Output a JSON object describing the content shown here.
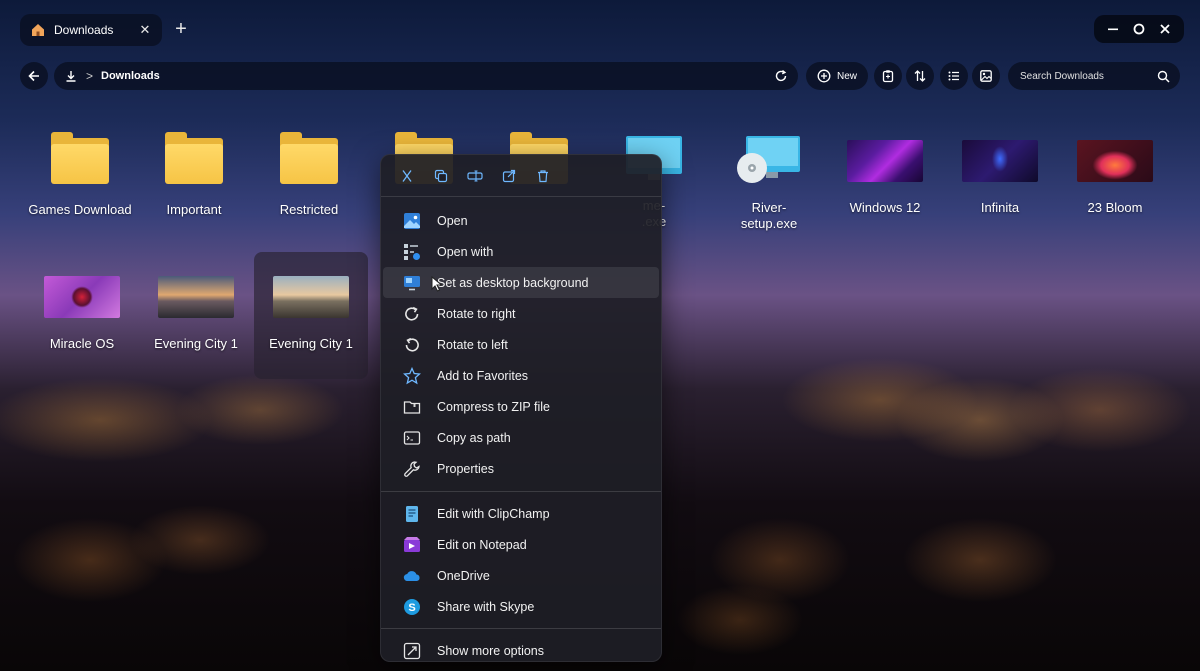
{
  "tab": {
    "title": "Downloads",
    "close_glyph": "✕"
  },
  "new_tab_glyph": "+",
  "address": {
    "crumb": "Downloads",
    "chevron": ">"
  },
  "toolbar": {
    "new_label": "New"
  },
  "search": {
    "placeholder": "Search Downloads"
  },
  "files": [
    {
      "name": "Games Download",
      "kind": "folder"
    },
    {
      "name": "Important",
      "kind": "folder"
    },
    {
      "name": "Restricted",
      "kind": "folder"
    },
    {
      "name": "",
      "kind": "folder"
    },
    {
      "name": "",
      "kind": "folder"
    },
    {
      "name": "me-\n.exe",
      "kind": "monitor"
    },
    {
      "name": "River-\nsetup.exe",
      "kind": "installer"
    },
    {
      "name": "Windows 12",
      "kind": "image"
    },
    {
      "name": "Infinita",
      "kind": "image"
    },
    {
      "name": "23 Bloom",
      "kind": "image"
    },
    {
      "name": "Miracle OS",
      "kind": "image"
    },
    {
      "name": "Evening City 1",
      "kind": "image"
    },
    {
      "name": "Evening City 1",
      "kind": "image",
      "selected": true
    }
  ],
  "menu": {
    "quick_actions": [
      "cut-icon",
      "copy-icon",
      "rename-icon",
      "share-icon",
      "delete-icon"
    ],
    "items": [
      {
        "label": "Open",
        "icon": "image-icon"
      },
      {
        "label": "Open with",
        "icon": "open-with-icon"
      },
      {
        "label": "Set as desktop background",
        "icon": "desktop-background-icon"
      },
      {
        "label": "Rotate to right",
        "icon": "rotate-right-icon"
      },
      {
        "label": "Rotate to left",
        "icon": "rotate-left-icon"
      },
      {
        "label": "Add to Favorites",
        "icon": "star-icon"
      },
      {
        "label": "Compress to ZIP file",
        "icon": "zip-folder-icon"
      },
      {
        "label": "Copy as path",
        "icon": "copy-path-icon"
      },
      {
        "label": "Properties",
        "icon": "wrench-icon"
      }
    ],
    "app_items": [
      {
        "label": "Edit with ClipChamp",
        "icon": "clipchamp-icon"
      },
      {
        "label": "Edit on Notepad",
        "icon": "notepad-icon"
      },
      {
        "label": "OneDrive",
        "icon": "onedrive-icon"
      },
      {
        "label": "Share with Skype",
        "icon": "skype-icon"
      }
    ],
    "more": {
      "label": "Show more options",
      "icon": "show-more-icon"
    }
  },
  "colors": {
    "folder": "#f6c445",
    "accent": "#4aa3ff"
  }
}
